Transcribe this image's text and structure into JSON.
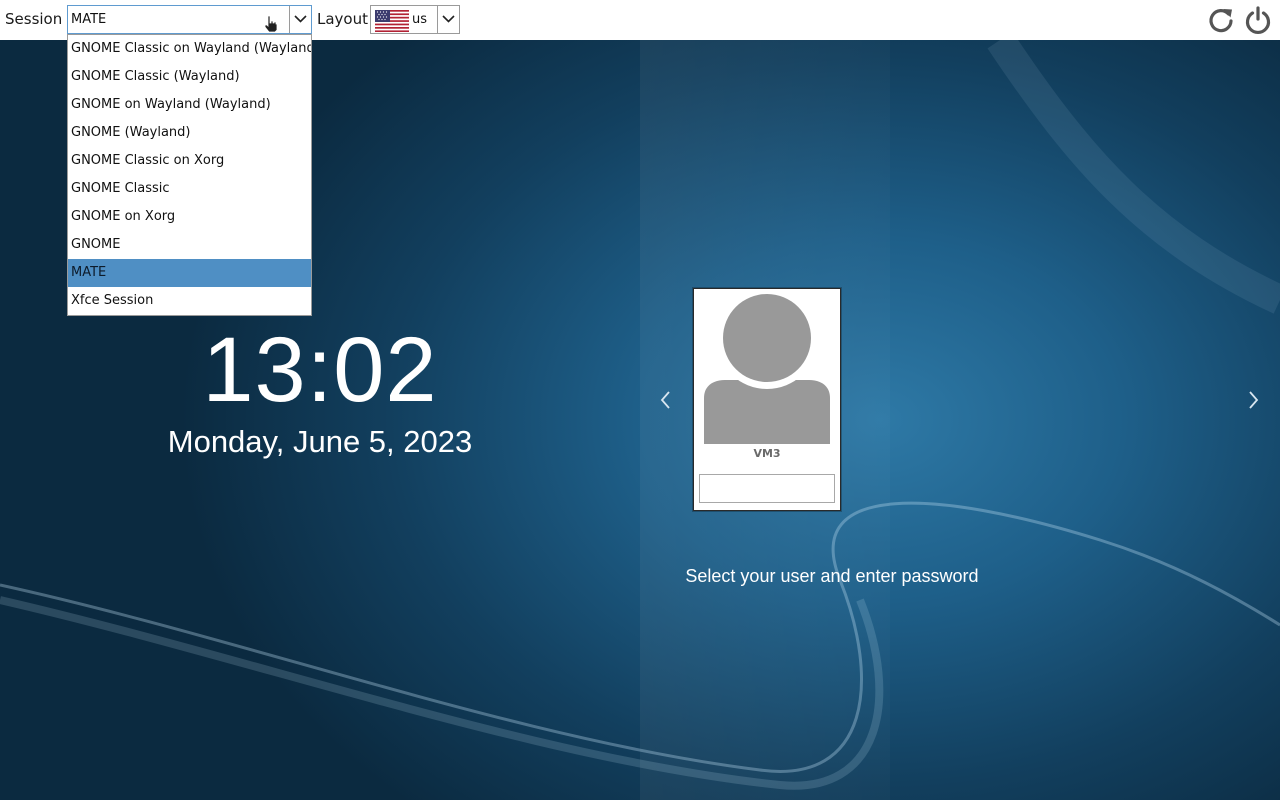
{
  "topbar": {
    "session_label": "Session",
    "session_value": "MATE",
    "layout_label": "Layout",
    "layout_value": "us"
  },
  "session_options": [
    "GNOME Classic on Wayland (Wayland)",
    "GNOME Classic (Wayland)",
    "GNOME on Wayland (Wayland)",
    "GNOME (Wayland)",
    "GNOME Classic on Xorg",
    "GNOME Classic",
    "GNOME on Xorg",
    "GNOME",
    "MATE",
    "Xfce Session"
  ],
  "selected_session": "MATE",
  "clock": {
    "time": "13:02",
    "date": "Monday, June 5, 2023"
  },
  "user": {
    "name": "VM3",
    "password_value": ""
  },
  "hint": "Select your user and enter password",
  "icons": {
    "restart": "restart-icon",
    "shutdown": "power-icon",
    "prev": "chevron-left-icon",
    "next": "chevron-right-icon",
    "flag": "us-flag-icon"
  },
  "colors": {
    "selected_item": "#4f8fc4",
    "select_focus_border": "#5f9bd0",
    "avatar": "#999999",
    "icon_gray": "#555555"
  }
}
